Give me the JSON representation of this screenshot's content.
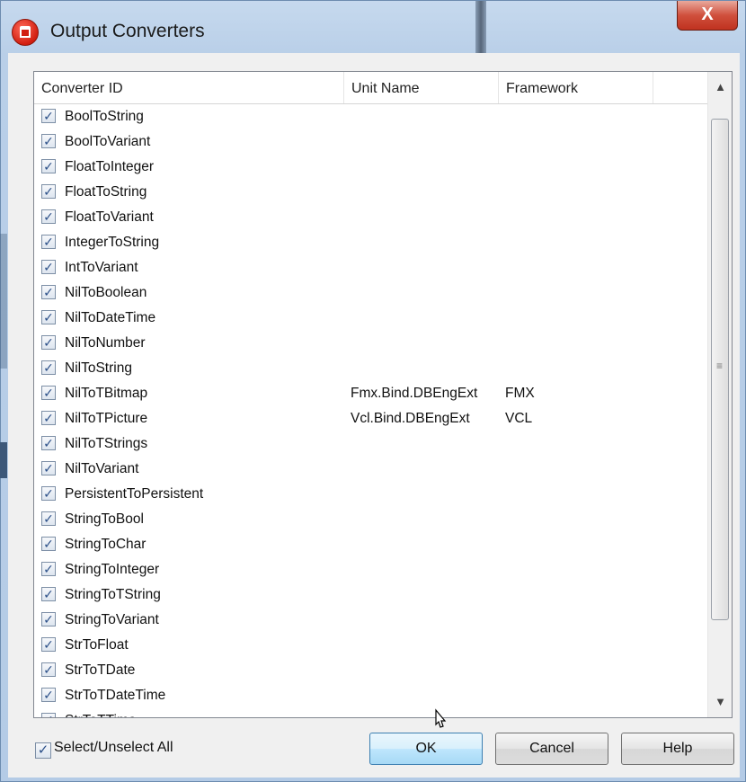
{
  "window": {
    "title": "Output Converters",
    "close_label": "X"
  },
  "icons": {
    "app": "output-converters-app-icon",
    "close": "close-icon",
    "checkbox": "checkmark-icon",
    "scroll_up": "scroll-up-arrow-icon",
    "scroll_down": "scroll-down-arrow-icon",
    "grip": "scroll-grip-icon",
    "cursor": "mouse-pointer-icon"
  },
  "list": {
    "columns": [
      "Converter ID",
      "Unit Name",
      "Framework"
    ],
    "rows": [
      {
        "checked": true,
        "id": "BoolToString",
        "unit": "",
        "framework": ""
      },
      {
        "checked": true,
        "id": "BoolToVariant",
        "unit": "",
        "framework": ""
      },
      {
        "checked": true,
        "id": "FloatToInteger",
        "unit": "",
        "framework": ""
      },
      {
        "checked": true,
        "id": "FloatToString",
        "unit": "",
        "framework": ""
      },
      {
        "checked": true,
        "id": "FloatToVariant",
        "unit": "",
        "framework": ""
      },
      {
        "checked": true,
        "id": "IntegerToString",
        "unit": "",
        "framework": ""
      },
      {
        "checked": true,
        "id": "IntToVariant",
        "unit": "",
        "framework": ""
      },
      {
        "checked": true,
        "id": "NilToBoolean",
        "unit": "",
        "framework": ""
      },
      {
        "checked": true,
        "id": "NilToDateTime",
        "unit": "",
        "framework": ""
      },
      {
        "checked": true,
        "id": "NilToNumber",
        "unit": "",
        "framework": ""
      },
      {
        "checked": true,
        "id": "NilToString",
        "unit": "",
        "framework": ""
      },
      {
        "checked": true,
        "id": "NilToTBitmap",
        "unit": "Fmx.Bind.DBEngExt",
        "framework": "FMX"
      },
      {
        "checked": true,
        "id": "NilToTPicture",
        "unit": "Vcl.Bind.DBEngExt",
        "framework": "VCL"
      },
      {
        "checked": true,
        "id": "NilToTStrings",
        "unit": "",
        "framework": ""
      },
      {
        "checked": true,
        "id": "NilToVariant",
        "unit": "",
        "framework": ""
      },
      {
        "checked": true,
        "id": "PersistentToPersistent",
        "unit": "",
        "framework": ""
      },
      {
        "checked": true,
        "id": "StringToBool",
        "unit": "",
        "framework": ""
      },
      {
        "checked": true,
        "id": "StringToChar",
        "unit": "",
        "framework": ""
      },
      {
        "checked": true,
        "id": "StringToInteger",
        "unit": "",
        "framework": ""
      },
      {
        "checked": true,
        "id": "StringToTString",
        "unit": "",
        "framework": ""
      },
      {
        "checked": true,
        "id": "StringToVariant",
        "unit": "",
        "framework": ""
      },
      {
        "checked": true,
        "id": "StrToFloat",
        "unit": "",
        "framework": ""
      },
      {
        "checked": true,
        "id": "StrToTDate",
        "unit": "",
        "framework": ""
      },
      {
        "checked": true,
        "id": "StrToTDateTime",
        "unit": "",
        "framework": ""
      },
      {
        "checked": true,
        "id": "StrToTTime",
        "unit": "",
        "framework": ""
      }
    ]
  },
  "footer": {
    "select_all_label": "Select/Unselect All",
    "select_all_checked": true,
    "ok_label": "OK",
    "cancel_label": "Cancel",
    "help_label": "Help"
  }
}
